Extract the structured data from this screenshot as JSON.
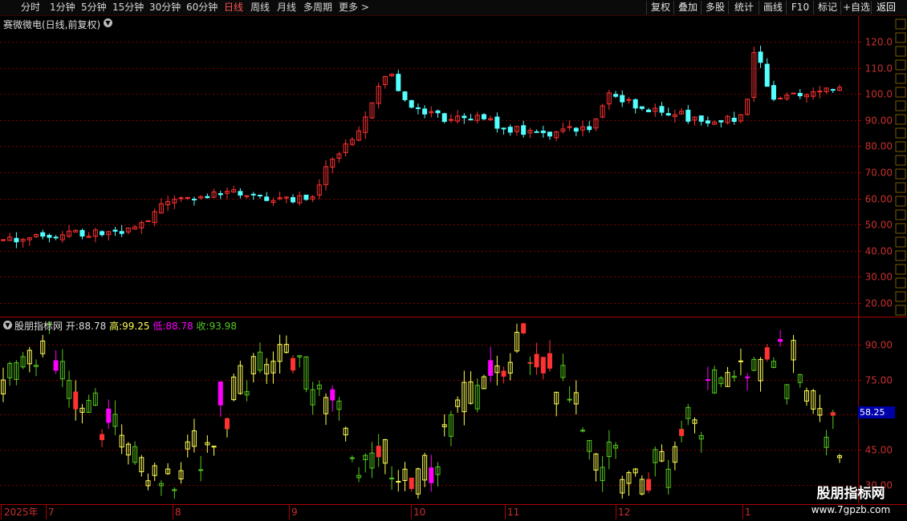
{
  "toolbar": {
    "left": [
      "分时",
      "1分钟",
      "5分钟",
      "15分钟",
      "30分钟",
      "60分钟",
      "日线",
      "周线",
      "月线",
      "多周期",
      "更多 >"
    ],
    "active": "日线",
    "right": [
      "复权",
      "叠加",
      "多股",
      "统计",
      "画线",
      "F10",
      "标记",
      "+自选",
      "返回"
    ]
  },
  "main": {
    "title": "赛微微电(日线,前复权)",
    "y_ticks": [
      "120.0",
      "110.0",
      "100.0",
      "90.00",
      "80.00",
      "70.00",
      "60.00",
      "50.00",
      "40.00",
      "30.00",
      "20.00"
    ]
  },
  "indicator": {
    "name": "股朋指标网",
    "open_label": "开:",
    "open": "88.78",
    "high_label": "高:",
    "high": "99.25",
    "low_label": "低:",
    "low": "88.78",
    "close_label": "收:",
    "close": "93.98",
    "y_ticks": [
      "90.00",
      "75.00",
      "60.00",
      "45.00",
      "30.00"
    ],
    "price_tag": "58.25"
  },
  "x_axis": {
    "year_label": "2025年",
    "months": [
      "7",
      "8",
      "9",
      "10",
      "11",
      "12",
      "1"
    ]
  },
  "watermark": {
    "title": "股朋指标网",
    "url": "www.7gpzb.com"
  },
  "colors": {
    "up": "#ff3232",
    "down": "#54ffff",
    "yellow": "#ffff54",
    "green": "#54c81e",
    "magenta": "#ff00ff"
  },
  "chart_data": {
    "type": "candlestick",
    "y_range_main": [
      15,
      125
    ],
    "y_range_indicator": [
      22,
      101
    ],
    "days": 128
  }
}
